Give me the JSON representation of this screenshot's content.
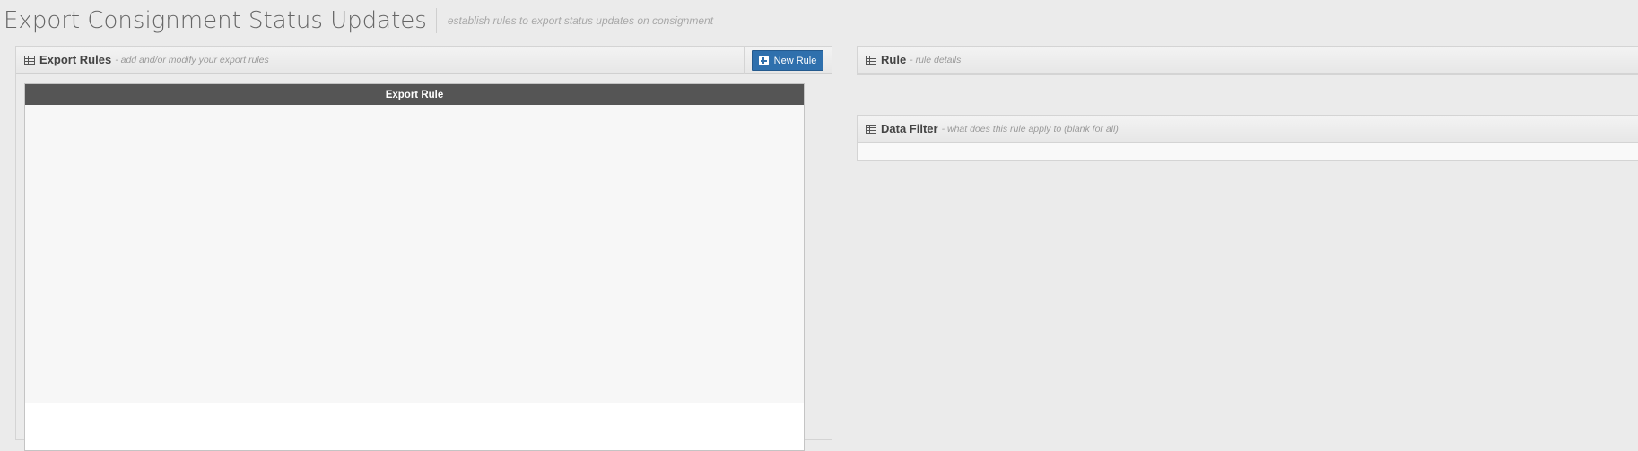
{
  "page": {
    "title": "Export Consignment Status Updates",
    "subtitle": "establish rules to export status updates on consignment"
  },
  "export_rules": {
    "title": "Export Rules",
    "desc": "- add and/or modify your export rules",
    "new_rule_label": "New Rule",
    "grid": {
      "columns": [
        "Export Rule"
      ],
      "rows": []
    }
  },
  "rule": {
    "title": "Rule",
    "desc": "- rule details"
  },
  "data_filter": {
    "title": "Data Filter",
    "desc": "- what does this rule apply to (blank for all)"
  },
  "icons": {
    "widget_header": "table-icon",
    "new_rule": "plus-square-icon"
  },
  "colors": {
    "primary_button": "#2f70ad",
    "grid_header": "#555555",
    "page_background": "#ebebeb"
  }
}
